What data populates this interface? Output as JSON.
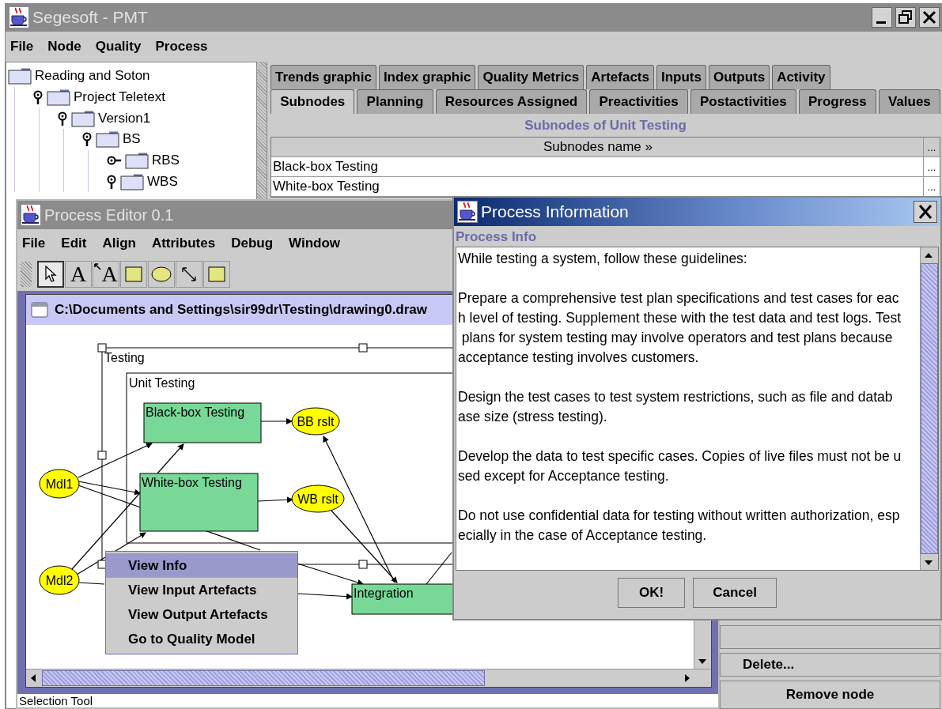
{
  "main_window": {
    "title": "Segesoft - PMT",
    "menu": [
      "File",
      "Node",
      "Quality",
      "Process"
    ]
  },
  "tree": [
    {
      "label": "Reading and Soton",
      "children": [
        {
          "label": "Project Teletext",
          "expanded": true,
          "children": [
            {
              "label": "Version1",
              "expanded": true,
              "children": [
                {
                  "label": "BS",
                  "expanded": true,
                  "children": [
                    {
                      "label": "RBS",
                      "expanded": false
                    },
                    {
                      "label": "WBS",
                      "expanded": true
                    }
                  ]
                }
              ]
            }
          ]
        }
      ]
    }
  ],
  "tabs": [
    [
      {
        "label": "Trends graphic",
        "selected": false
      },
      {
        "label": "Index graphic",
        "selected": false
      },
      {
        "label": "Quality Metrics",
        "selected": false
      },
      {
        "label": "Artefacts",
        "selected": false
      },
      {
        "label": "Inputs",
        "selected": false
      },
      {
        "label": "Outputs",
        "selected": false
      },
      {
        "label": "Activity",
        "selected": false
      }
    ],
    [
      {
        "label": "Subnodes",
        "selected": true
      },
      {
        "label": "Planning",
        "selected": false
      },
      {
        "label": "Resources Assigned",
        "selected": false
      },
      {
        "label": "Preactivities",
        "selected": false
      },
      {
        "label": "Postactivities",
        "selected": false
      },
      {
        "label": "Progress",
        "selected": false
      },
      {
        "label": "Values",
        "selected": false
      }
    ]
  ],
  "subnodes_panel": {
    "title": "Subnodes of Unit Testing",
    "columns": [
      "Subnodes name »",
      "..."
    ],
    "rows": [
      [
        "Black-box Testing",
        "..."
      ],
      [
        "White-box Testing",
        "..."
      ]
    ]
  },
  "side_buttons": [
    "Delete...",
    "Remove node"
  ],
  "process_editor": {
    "title": "Process Editor 0.1",
    "menu": [
      "File",
      "Edit",
      "Align",
      "Attributes",
      "Debug",
      "Window"
    ],
    "tools": [
      {
        "kind": "pointer",
        "selected": true
      },
      {
        "kind": "text",
        "glyph": "A",
        "selected": false
      },
      {
        "kind": "connected-text",
        "glyph": "A",
        "selected": false
      },
      {
        "kind": "rectangle",
        "selected": false
      },
      {
        "kind": "ellipse",
        "selected": false
      },
      {
        "kind": "line",
        "selected": false
      },
      {
        "kind": "rectangle",
        "selected": false
      }
    ],
    "document": {
      "title": "C:\\Documents and Settings\\sir99dr\\Testing\\drawing0.draw",
      "nodes": [
        {
          "kind": "container",
          "label": "Testing"
        },
        {
          "kind": "container",
          "label": "Unit Testing"
        },
        {
          "kind": "activity",
          "label": "Black-box Testing"
        },
        {
          "kind": "artefact",
          "label": "BB rslt"
        },
        {
          "kind": "activity",
          "label": "White-box Testing"
        },
        {
          "kind": "artefact",
          "label": "WB rslt"
        },
        {
          "kind": "artefact",
          "label": "Mdl1"
        },
        {
          "kind": "artefact",
          "label": "Mdl2"
        },
        {
          "kind": "activity",
          "label": "Integration"
        }
      ]
    },
    "status": "Selection Tool"
  },
  "context_menu": [
    {
      "label": "View Info",
      "selected": true
    },
    {
      "label": "View Input Artefacts",
      "selected": false
    },
    {
      "label": "View Output Artefacts",
      "selected": false
    },
    {
      "label": "Go to Quality Model",
      "selected": false
    }
  ],
  "dialog": {
    "title": "Process Information",
    "section": "Process Info",
    "paragraphs": [
      [
        "While testing a system, follow these guidelines:"
      ],
      [
        "Prepare a comprehensive test plan specifications and test cases for eac",
        "h level of testing. Supplement these with the test data and test logs. Test",
        " plans for system testing may involve operators and test plans because",
        "acceptance testing involves customers."
      ],
      [
        "Design the test cases to test system restrictions, such as file and datab",
        "ase size (stress testing)."
      ],
      [
        "Develop the data to test specific cases. Copies of live files must not be u",
        "sed except for Acceptance testing."
      ],
      [
        "Do not use confidential data for testing without written authorization, esp",
        "ecially in the case of Acceptance testing."
      ]
    ],
    "buttons": [
      "OK!",
      "Cancel"
    ]
  }
}
